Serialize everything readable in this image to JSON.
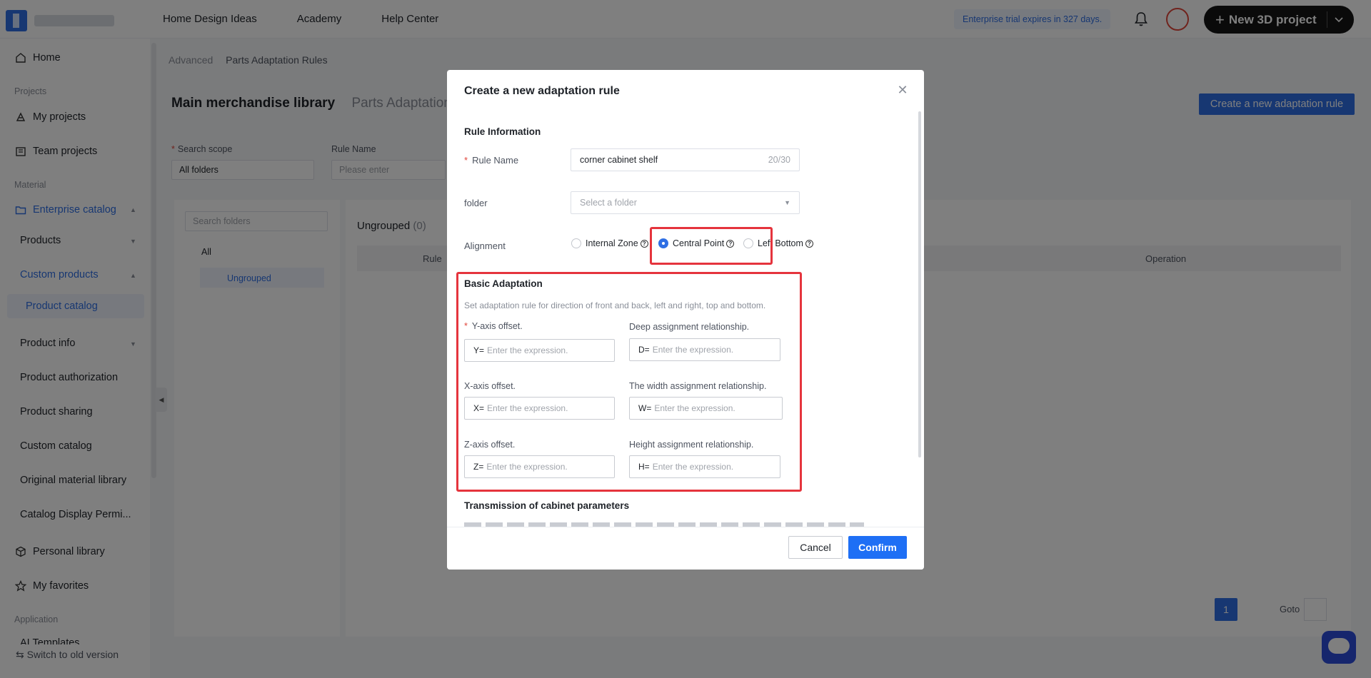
{
  "topbar": {
    "nav": [
      "Home Design Ideas",
      "Academy",
      "Help Center"
    ],
    "trial": "Enterprise trial expires in 327 days.",
    "new_project": "New 3D project"
  },
  "sidebar": {
    "home": "Home",
    "group_projects": "Projects",
    "my_projects": "My projects",
    "team_projects": "Team projects",
    "group_material": "Material",
    "enterprise_catalog": "Enterprise catalog",
    "products": "Products",
    "custom_products": "Custom products",
    "product_catalog": "Product catalog",
    "product_info": "Product info",
    "product_authorization": "Product authorization",
    "product_sharing": "Product sharing",
    "custom_catalog": "Custom catalog",
    "original_material_library": "Original material library",
    "catalog_display": "Catalog Display Permi...",
    "personal_library": "Personal library",
    "my_favorites": "My favorites",
    "group_application": "Application",
    "ai_templates": "AI Templates",
    "switch_old": "Switch to old version"
  },
  "main": {
    "breadcrumb_root": "Advanced",
    "breadcrumb_current": "Parts Adaptation Rules",
    "tab_main": "Main merchandise library",
    "tab_parts": "Parts Adaptation",
    "create_button": "Create a new adaptation rule",
    "search_scope_label": "Search scope",
    "search_scope_value": "All folders",
    "rule_name_label": "Rule Name",
    "rule_name_placeholder": "Please enter",
    "search_folders_placeholder": "Search folders",
    "tree_all": "All",
    "tree_ungrouped": "Ungrouped",
    "list_title": "Ungrouped",
    "list_count": "(0)",
    "col_rule": "Rule",
    "col_operation": "Operation",
    "page": "1",
    "goto": "Goto"
  },
  "modal": {
    "title": "Create a new adaptation rule",
    "section_rule_info": "Rule Information",
    "rule_name_label": "Rule Name",
    "rule_name_value": "corner cabinet shelf",
    "rule_name_count": "20/30",
    "folder_label": "folder",
    "folder_placeholder": "Select a folder",
    "alignment_label": "Alignment",
    "alignment_options": [
      "Internal Zone",
      "Central Point",
      "Left Bottom"
    ],
    "alignment_selected": "Central Point",
    "section_basic": "Basic Adaptation",
    "basic_desc": "Set adaptation rule for direction of front and back, left and right, top and bottom.",
    "y_label": "Y-axis offset.",
    "y_prefix": "Y=",
    "x_label": "X-axis offset.",
    "x_prefix": "X=",
    "z_label": "Z-axis offset.",
    "z_prefix": "Z=",
    "d_label": "Deep assignment relationship.",
    "d_prefix": "D=",
    "w_label": "The width assignment relationship.",
    "w_prefix": "W=",
    "h_label": "Height assignment relationship.",
    "h_prefix": "H=",
    "expr_placeholder": "Enter the expression.",
    "section_transmission": "Transmission of cabinet parameters",
    "cancel": "Cancel",
    "confirm": "Confirm"
  },
  "colors": {
    "accent": "#2f6fe4",
    "confirm": "#1e6ff5",
    "highlight": "#e5343d",
    "required": "#e0463b"
  }
}
